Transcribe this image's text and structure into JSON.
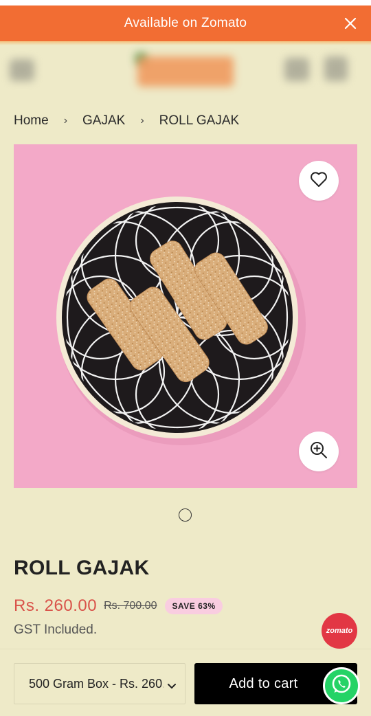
{
  "announcement": {
    "text": "Available on Zomato"
  },
  "breadcrumb": {
    "items": [
      "Home",
      "GAJAK",
      "ROLL GAJAK"
    ]
  },
  "product": {
    "title": "ROLL GAJAK",
    "price": "Rs. 260.00",
    "compare_price": "Rs. 700.00",
    "save_badge": "SAVE 63%",
    "tax_note": "GST Included."
  },
  "badge": {
    "zomato_label": "zomato"
  },
  "purchase": {
    "variant_selected": "500 Gram Box - Rs. 260.00",
    "add_to_cart_label": "Add to cart"
  },
  "colors": {
    "announce_bg": "#f26d33",
    "page_bg": "#eeeac8",
    "image_bg": "#f3a9c8",
    "price": "#d9534a",
    "save_badge_bg": "#f9cde0",
    "zomato_red": "#e23744",
    "whatsapp_green": "#25d366"
  },
  "icons": [
    "close-icon",
    "heart-icon",
    "zoom-in-icon",
    "chevron-down-icon",
    "whatsapp-icon"
  ]
}
